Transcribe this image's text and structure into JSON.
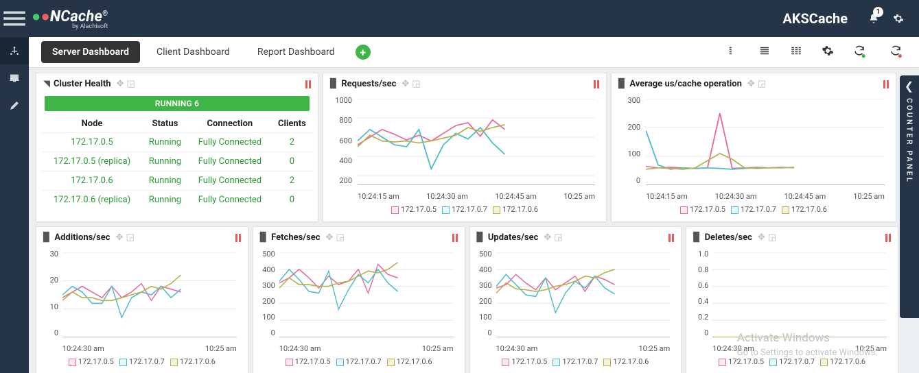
{
  "colors": {
    "series5": "#e86aa2",
    "series6": "#b8b04a",
    "series7": "#4dbcc9",
    "running": "#3fb548"
  },
  "brand": {
    "name": "NCache",
    "by": "by Alachisoft"
  },
  "cache_name": "AKSCache",
  "notifications": 1,
  "tabs": {
    "server": "Server Dashboard",
    "client": "Client Dashboard",
    "report": "Report Dashboard"
  },
  "counter_panel_label": "COUNTER PANEL",
  "watermark": {
    "line1": "Activate Windows",
    "line2": "Go to Settings to activate Windows."
  },
  "legend": {
    "s5": "172.17.0.5",
    "s7": "172.17.0.7",
    "s6": "172.17.0.6"
  },
  "cluster_health": {
    "title": "Cluster Health",
    "running_bar": "RUNNING 6",
    "headers": {
      "node": "Node",
      "status": "Status",
      "conn": "Connection",
      "clients": "Clients"
    },
    "rows": [
      {
        "node": "172.17.0.5",
        "status": "Running",
        "conn": "Fully Connected",
        "clients": "2"
      },
      {
        "node": "172.17.0.5 (replica)",
        "status": "Running",
        "conn": "Fully Connected",
        "clients": "0"
      },
      {
        "node": "172.17.0.6",
        "status": "Running",
        "conn": "Fully Connected",
        "clients": "2"
      },
      {
        "node": "172.17.0.6 (replica)",
        "status": "Running",
        "conn": "Fully Connected",
        "clients": "0"
      }
    ]
  },
  "chart_data": [
    {
      "id": "requests",
      "type": "line",
      "title": "Requests/sec",
      "yticks": [
        200,
        400,
        600,
        800,
        1000
      ],
      "ylim": [
        100,
        1000
      ],
      "xticks": [
        "10:24:15 am",
        "10:24:30 am",
        "10:24:45 am",
        "10:25 am"
      ],
      "x": [
        0,
        1,
        2,
        3,
        4,
        5,
        6,
        7,
        8,
        9,
        10,
        11,
        12
      ],
      "series": [
        {
          "name": "172.17.0.5",
          "values": [
            520,
            600,
            680,
            630,
            570,
            620,
            560,
            640,
            720,
            750,
            610,
            780,
            680
          ]
        },
        {
          "name": "172.17.0.7",
          "values": [
            560,
            680,
            600,
            520,
            500,
            680,
            270,
            520,
            640,
            580,
            700,
            540,
            420
          ]
        },
        {
          "name": "172.17.0.6",
          "values": [
            500,
            620,
            560,
            550,
            560,
            540,
            560,
            590,
            620,
            700,
            660,
            700,
            730
          ]
        }
      ]
    },
    {
      "id": "avg_us",
      "type": "line",
      "title": "Average us/cache operation",
      "yticks": [
        0,
        100,
        200,
        300
      ],
      "ylim": [
        0,
        300
      ],
      "xticks": [
        "10:24:15 am",
        "10:24:30 am",
        "10:24:45 am",
        "10:25 am"
      ],
      "x": [
        0,
        1,
        2,
        3,
        4,
        5,
        6,
        7,
        8,
        9,
        10,
        11,
        12
      ],
      "series": [
        {
          "name": "172.17.0.5",
          "values": [
            65,
            60,
            62,
            60,
            58,
            60,
            250,
            58,
            60,
            62,
            60,
            60,
            62
          ]
        },
        {
          "name": "172.17.0.7",
          "values": [
            190,
            70,
            55,
            60,
            58,
            60,
            58,
            55,
            58,
            60,
            60,
            62,
            60
          ]
        },
        {
          "name": "172.17.0.6",
          "values": [
            55,
            60,
            58,
            55,
            60,
            85,
            110,
            90,
            60,
            58,
            60,
            62,
            60
          ]
        }
      ]
    },
    {
      "id": "additions",
      "type": "line",
      "title": "Additions/sec",
      "yticks": [
        0,
        10,
        20,
        30
      ],
      "ylim": [
        0,
        30
      ],
      "xticks": [
        "10:24:30 am",
        "10:25 am"
      ],
      "x": [
        0,
        1,
        2,
        3,
        4,
        5,
        6,
        7,
        8,
        9,
        10,
        11,
        12
      ],
      "series": [
        {
          "name": "172.17.0.5",
          "values": [
            14,
            16,
            18,
            16,
            14,
            18,
            14,
            16,
            19,
            13,
            18,
            17,
            16
          ]
        },
        {
          "name": "172.17.0.7",
          "values": [
            15,
            18,
            16,
            12,
            12,
            18,
            7,
            14,
            16,
            15,
            18,
            14,
            17
          ]
        },
        {
          "name": "172.17.0.6",
          "values": [
            13,
            16,
            14,
            14,
            13,
            13,
            14,
            15,
            16,
            18,
            17,
            19,
            22
          ]
        }
      ]
    },
    {
      "id": "fetches",
      "type": "line",
      "title": "Fetches/sec",
      "yticks": [
        0,
        100,
        200,
        300,
        400,
        500
      ],
      "ylim": [
        0,
        500
      ],
      "xticks": [
        "10:24:30 am",
        "10:25 am"
      ],
      "x": [
        0,
        1,
        2,
        3,
        4,
        5,
        6,
        7,
        8,
        9,
        10,
        11,
        12
      ],
      "series": [
        {
          "name": "172.17.0.5",
          "values": [
            320,
            350,
            400,
            350,
            290,
            360,
            310,
            330,
            400,
            260,
            430,
            370,
            350
          ]
        },
        {
          "name": "172.17.0.7",
          "values": [
            330,
            400,
            340,
            270,
            260,
            390,
            165,
            280,
            370,
            320,
            400,
            320,
            270
          ]
        },
        {
          "name": "172.17.0.6",
          "values": [
            290,
            350,
            310,
            310,
            300,
            300,
            320,
            330,
            360,
            390,
            380,
            400,
            440
          ]
        }
      ]
    },
    {
      "id": "updates",
      "type": "line",
      "title": "Updates/sec",
      "yticks": [
        0,
        100,
        200,
        300,
        400,
        500
      ],
      "ylim": [
        0,
        500
      ],
      "xticks": [
        "10:24:30 am",
        "10:25 am"
      ],
      "x": [
        0,
        1,
        2,
        3,
        4,
        5,
        6,
        7,
        8,
        9,
        10,
        11,
        12
      ],
      "series": [
        {
          "name": "172.17.0.5",
          "values": [
            290,
            310,
            370,
            320,
            280,
            350,
            280,
            320,
            360,
            270,
            360,
            340,
            310
          ]
        },
        {
          "name": "172.17.0.7",
          "values": [
            300,
            370,
            310,
            250,
            240,
            350,
            145,
            260,
            330,
            290,
            360,
            290,
            255
          ]
        },
        {
          "name": "172.17.0.6",
          "values": [
            260,
            320,
            285,
            280,
            270,
            280,
            300,
            310,
            330,
            360,
            350,
            380,
            400
          ]
        }
      ]
    },
    {
      "id": "deletes",
      "type": "line",
      "title": "Deletes/sec",
      "yticks": [
        "0",
        "0.2",
        "0.4",
        "0.6",
        "0.8",
        "1.0"
      ],
      "ylim": [
        0,
        1
      ],
      "xticks": [
        "10:24:30 am",
        "10:25 am"
      ],
      "x": [
        0,
        1,
        2,
        3,
        4,
        5,
        6,
        7,
        8,
        9,
        10,
        11,
        12
      ],
      "series": [
        {
          "name": "172.17.0.5",
          "values": [
            0,
            0,
            0,
            0,
            0,
            0,
            0,
            0,
            0,
            0,
            0,
            0,
            0
          ]
        },
        {
          "name": "172.17.0.7",
          "values": [
            0,
            0,
            0,
            0,
            0,
            0,
            0,
            0,
            0,
            0,
            0,
            0,
            0
          ]
        },
        {
          "name": "172.17.0.6",
          "values": [
            0,
            0,
            0,
            0,
            0,
            0,
            0,
            0,
            0,
            0,
            0,
            0,
            0
          ]
        }
      ]
    }
  ]
}
